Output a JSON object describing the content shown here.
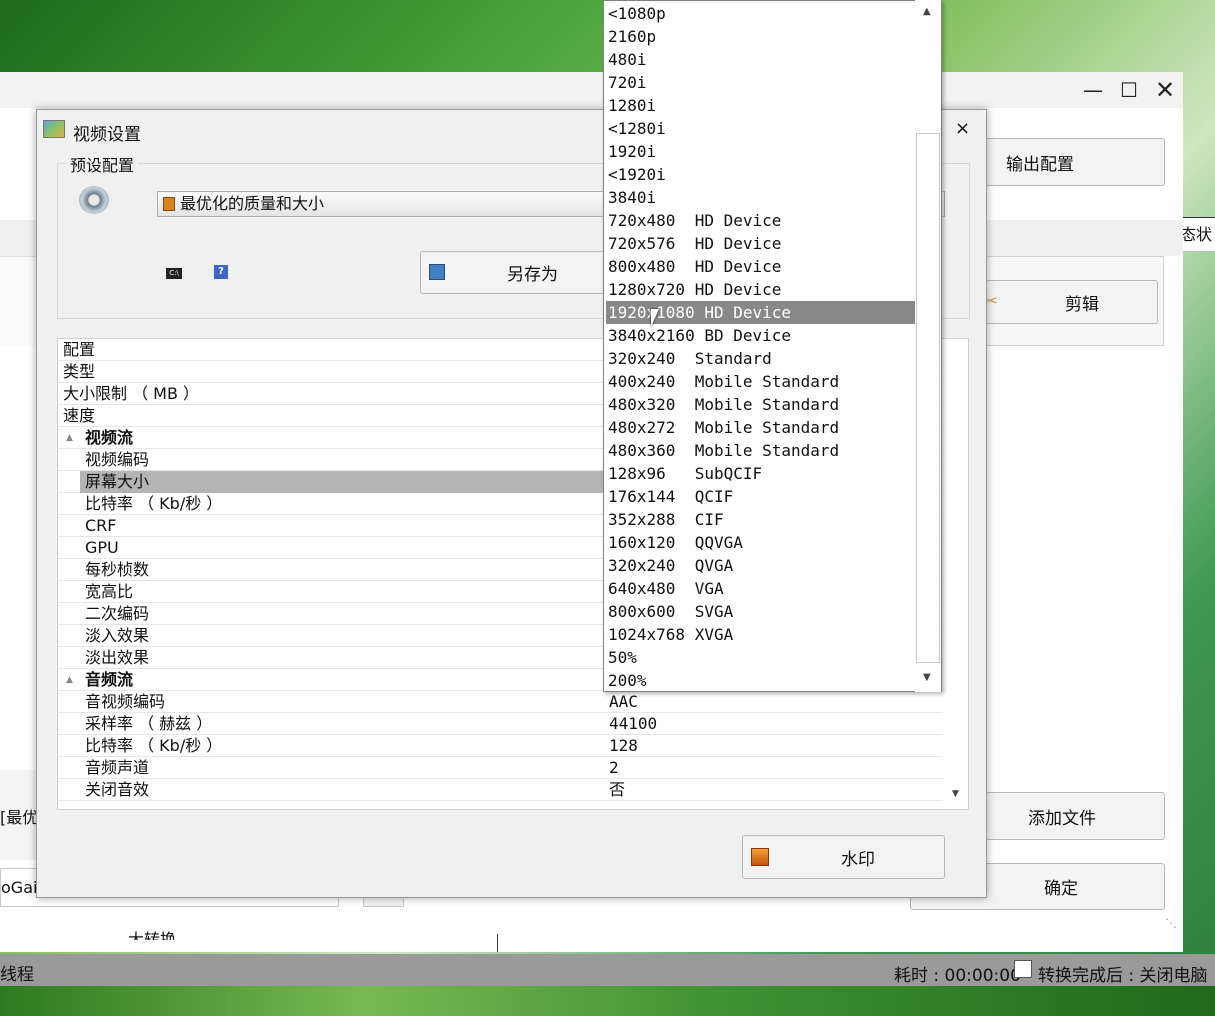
{
  "main_window": {
    "output_config_label": "输出配置",
    "cut_label": "剪辑",
    "add_file_label": "添加文件",
    "ok_label": "确定",
    "status_partial": "态状",
    "left_partial_1": "[最优",
    "left_partial_2": "oGai\\",
    "left_partial_3": "大转换",
    "status_bar": {
      "left_text": "线程",
      "elapsed_label": "耗时 : 00:00:00",
      "after_convert_label": "转换完成后 : 关闭电脑"
    }
  },
  "dialog": {
    "title": "视频设置",
    "preset_group_label": "预设配置",
    "preset_selected": "最优化的质量和大小",
    "save_as_label": "另存为",
    "watermark_label": "水印",
    "properties": [
      {
        "name": "配置",
        "value": "",
        "level": 0,
        "type": "row"
      },
      {
        "name": "类型",
        "value": "",
        "level": 0,
        "type": "row"
      },
      {
        "name": "大小限制 （ MB ）",
        "value": "",
        "level": 0,
        "type": "row"
      },
      {
        "name": "速度",
        "value": "",
        "level": 0,
        "type": "row"
      },
      {
        "name": "视频流",
        "value": "",
        "level": 0,
        "type": "category"
      },
      {
        "name": "视频编码",
        "value": "",
        "level": 1,
        "type": "row"
      },
      {
        "name": "屏幕大小",
        "value": "",
        "level": 1,
        "type": "row",
        "selected": true
      },
      {
        "name": "比特率 （ Kb/秒 ）",
        "value": "",
        "level": 1,
        "type": "row"
      },
      {
        "name": "CRF",
        "value": "",
        "level": 1,
        "type": "row"
      },
      {
        "name": "GPU",
        "value": "",
        "level": 1,
        "type": "row"
      },
      {
        "name": "每秒桢数",
        "value": "",
        "level": 1,
        "type": "row"
      },
      {
        "name": "宽高比",
        "value": "",
        "level": 1,
        "type": "row"
      },
      {
        "name": "二次编码",
        "value": "",
        "level": 1,
        "type": "row"
      },
      {
        "name": "淡入效果",
        "value": "",
        "level": 1,
        "type": "row"
      },
      {
        "name": "淡出效果",
        "value": "",
        "level": 1,
        "type": "row"
      },
      {
        "name": "音频流",
        "value": "",
        "level": 0,
        "type": "category"
      },
      {
        "name": "音视频编码",
        "value": "AAC",
        "level": 1,
        "type": "row"
      },
      {
        "name": "采样率 （ 赫兹 ）",
        "value": "44100",
        "level": 1,
        "type": "row"
      },
      {
        "name": "比特率 （ Kb/秒 ）",
        "value": "128",
        "level": 1,
        "type": "row"
      },
      {
        "name": "音频声道",
        "value": "2",
        "level": 1,
        "type": "row"
      },
      {
        "name": "关闭音效",
        "value": "否",
        "level": 1,
        "type": "row"
      }
    ]
  },
  "dropdown": {
    "highlighted": "1920x1080 HD Device",
    "items": [
      "<1080p",
      "2160p",
      "480i",
      "720i",
      "1280i",
      "<1280i",
      "1920i",
      "<1920i",
      "3840i",
      "720x480  HD Device",
      "720x576  HD Device",
      "800x480  HD Device",
      "1280x720 HD Device",
      "1920x1080 HD Device",
      "3840x2160 BD Device",
      "320x240  Standard",
      "400x240  Mobile Standard",
      "480x320  Mobile Standard",
      "480x272  Mobile Standard",
      "480x360  Mobile Standard",
      "128x96   SubQCIF",
      "176x144  QCIF",
      "352x288  CIF",
      "160x120  QQVGA",
      "320x240  QVGA",
      "640x480  VGA",
      "800x600  SVGA",
      "1024x768 XVGA",
      "50%",
      "200%"
    ]
  }
}
